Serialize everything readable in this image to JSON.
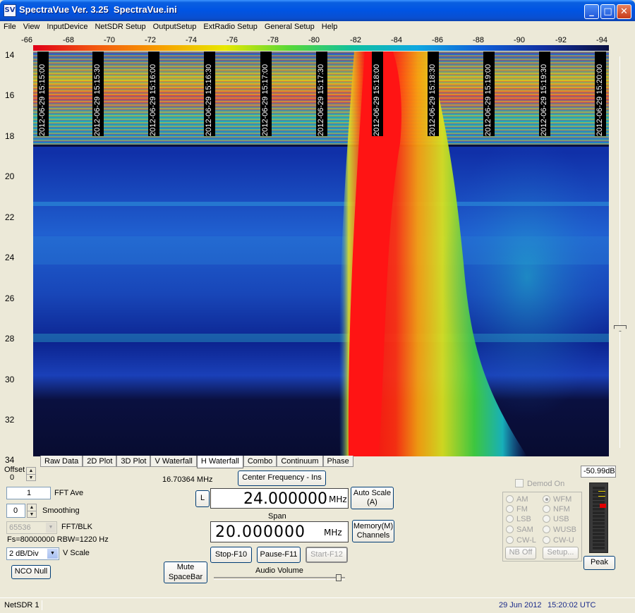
{
  "window": {
    "icon_text": "SV",
    "title": "SpectraVue Ver. 3.25  SpectraVue.ini",
    "minimize": "_",
    "maximize": "□",
    "close": "✕"
  },
  "menu": [
    "File",
    "View",
    "InputDevice",
    "NetSDR Setup",
    "OutputSetup",
    "ExtRadio Setup",
    "General Setup",
    "Help"
  ],
  "x_axis_ticks": [
    "-66",
    "-68",
    "-70",
    "-72",
    "-74",
    "-76",
    "-78",
    "-80",
    "-82",
    "-84",
    "-86",
    "-88",
    "-90",
    "-92",
    "-94"
  ],
  "y_axis_ticks": [
    "14",
    "16",
    "18",
    "20",
    "22",
    "24",
    "26",
    "28",
    "30",
    "32",
    "34"
  ],
  "timestamps": [
    "2012-06-29 15:15:00",
    "2012-06-29 15:15:30",
    "2012-06-29 15:16:00",
    "2012-06-29 15:16:30",
    "2012-06-29 15:17:00",
    "2012-06-29 15:17:30",
    "2012-06-29 15:18:00",
    "2012-06-29 15:18:30",
    "2012-06-29 15:19:00",
    "2012-06-29 15:19:30",
    "2012-06-29 15:20:00"
  ],
  "colors": {
    "title_bar": "#0054e3",
    "waterfall_background": "#0a1040",
    "signal_peak": "#ff1010",
    "demod_text_disabled": "#a0a0a0"
  },
  "tabs": [
    "Raw Data",
    "2D Plot",
    "3D Plot",
    "V Waterfall",
    "H Waterfall",
    "Combo",
    "Continuum",
    "Phase"
  ],
  "active_tab": "H Waterfall",
  "left_controls": {
    "offset_label": "Offset",
    "offset_value": "0",
    "fft_ave_value": "1",
    "fft_ave_label": "FFT Ave",
    "smoothing_value": "0",
    "smoothing_label": "Smoothing",
    "fft_blk_value": "65536",
    "fft_blk_label": "FFT/BLK",
    "fs_rbw": "Fs=80000000 RBW=1220 Hz",
    "vscale_value": "2 dB/Div",
    "vscale_label": "V Scale",
    "nco_null": "NCO Null"
  },
  "center_controls": {
    "cursor_freq": "16.70364 MHz",
    "center_freq_button": "Center Frequency - Ins",
    "l_button": "L",
    "center_freq_value": "24.000000",
    "center_freq_unit": "MHz",
    "auto_scale": "Auto Scale\n(A)",
    "span_label": "Span",
    "span_value": "20.000000",
    "span_unit": "MHz",
    "memory_channels": "Memory(M)\nChannels",
    "stop": "Stop-F10",
    "pause": "Pause-F11",
    "start": "Start-F12",
    "mute": "Mute\nSpaceBar",
    "audio_volume_label": "Audio Volume",
    "audio_volume_level": 0.95
  },
  "demod": {
    "level_readout": "-50.99dB",
    "demod_on_label": "Demod On",
    "modes_left": [
      "AM",
      "FM",
      "LSB",
      "SAM",
      "CW-L"
    ],
    "modes_right": [
      "WFM",
      "NFM",
      "USB",
      "WUSB",
      "CW-U"
    ],
    "selected_mode": "WFM",
    "nb_off": "NB Off",
    "setup": "Setup...",
    "peak": "Peak"
  },
  "status": {
    "device": "NetSDR 1",
    "date": "29 Jun 2012",
    "time": "15:20:02 UTC"
  }
}
